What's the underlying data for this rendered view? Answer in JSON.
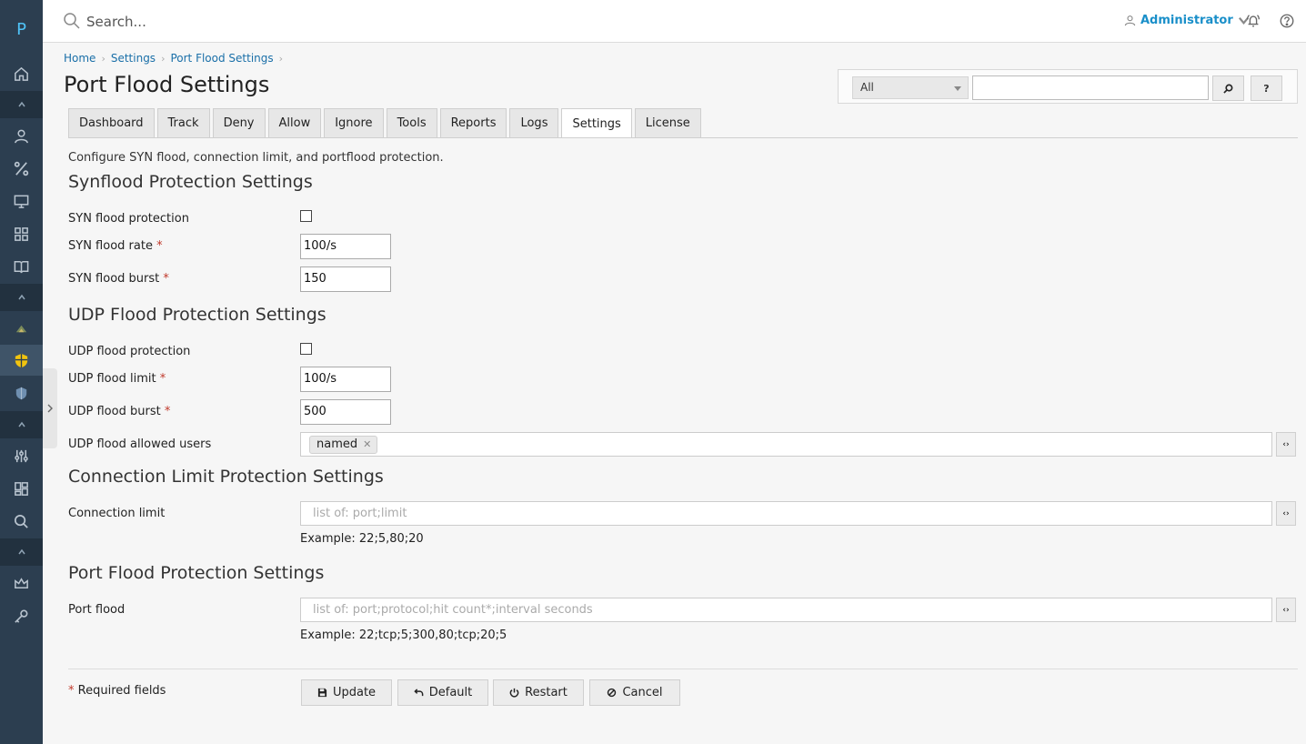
{
  "app": {
    "logo_letter": "P"
  },
  "header": {
    "search_placeholder": "Search...",
    "user_name": "Administrator"
  },
  "breadcrumb": [
    "Home",
    "Settings",
    "Port Flood Settings"
  ],
  "page_title": "Port Flood Settings",
  "filter": {
    "selected": "All",
    "search_button_icon": "magnifier-icon",
    "help_label": "?"
  },
  "tabs": [
    {
      "label": "Dashboard",
      "active": false
    },
    {
      "label": "Track",
      "active": false
    },
    {
      "label": "Deny",
      "active": false
    },
    {
      "label": "Allow",
      "active": false
    },
    {
      "label": "Ignore",
      "active": false
    },
    {
      "label": "Tools",
      "active": false
    },
    {
      "label": "Reports",
      "active": false
    },
    {
      "label": "Logs",
      "active": false
    },
    {
      "label": "Settings",
      "active": true
    },
    {
      "label": "License",
      "active": false
    }
  ],
  "description": "Configure SYN flood, connection limit, and portflood protection.",
  "synflood": {
    "heading": "Synflood Protection Settings",
    "protection_label": "SYN flood protection",
    "protection_checked": false,
    "rate_label": "SYN flood rate",
    "rate_value": "100/s",
    "burst_label": "SYN flood burst",
    "burst_value": "150"
  },
  "udpflood": {
    "heading": "UDP Flood Protection Settings",
    "protection_label": "UDP flood protection",
    "protection_checked": false,
    "limit_label": "UDP flood limit",
    "limit_value": "100/s",
    "burst_label": "UDP flood burst",
    "burst_value": "500",
    "users_label": "UDP flood allowed users",
    "users": [
      "named"
    ]
  },
  "connlimit": {
    "heading": "Connection Limit Protection Settings",
    "label": "Connection limit",
    "placeholder": "list of: port;limit",
    "example": "Example: 22;5,80;20"
  },
  "portflood": {
    "heading": "Port Flood Protection Settings",
    "label": "Port flood",
    "placeholder": "list of: port;protocol;hit count*;interval seconds",
    "example": "Example: 22;tcp;5;300,80;tcp;20;5"
  },
  "required_star": "*",
  "footer": {
    "required_note": "Required fields",
    "buttons": {
      "update": "Update",
      "default": "Default",
      "restart": "Restart",
      "cancel": "Cancel"
    }
  },
  "colors": {
    "sidebar": "#2c3e50",
    "accent": "#1a8fc9",
    "required": "#c0392b"
  }
}
